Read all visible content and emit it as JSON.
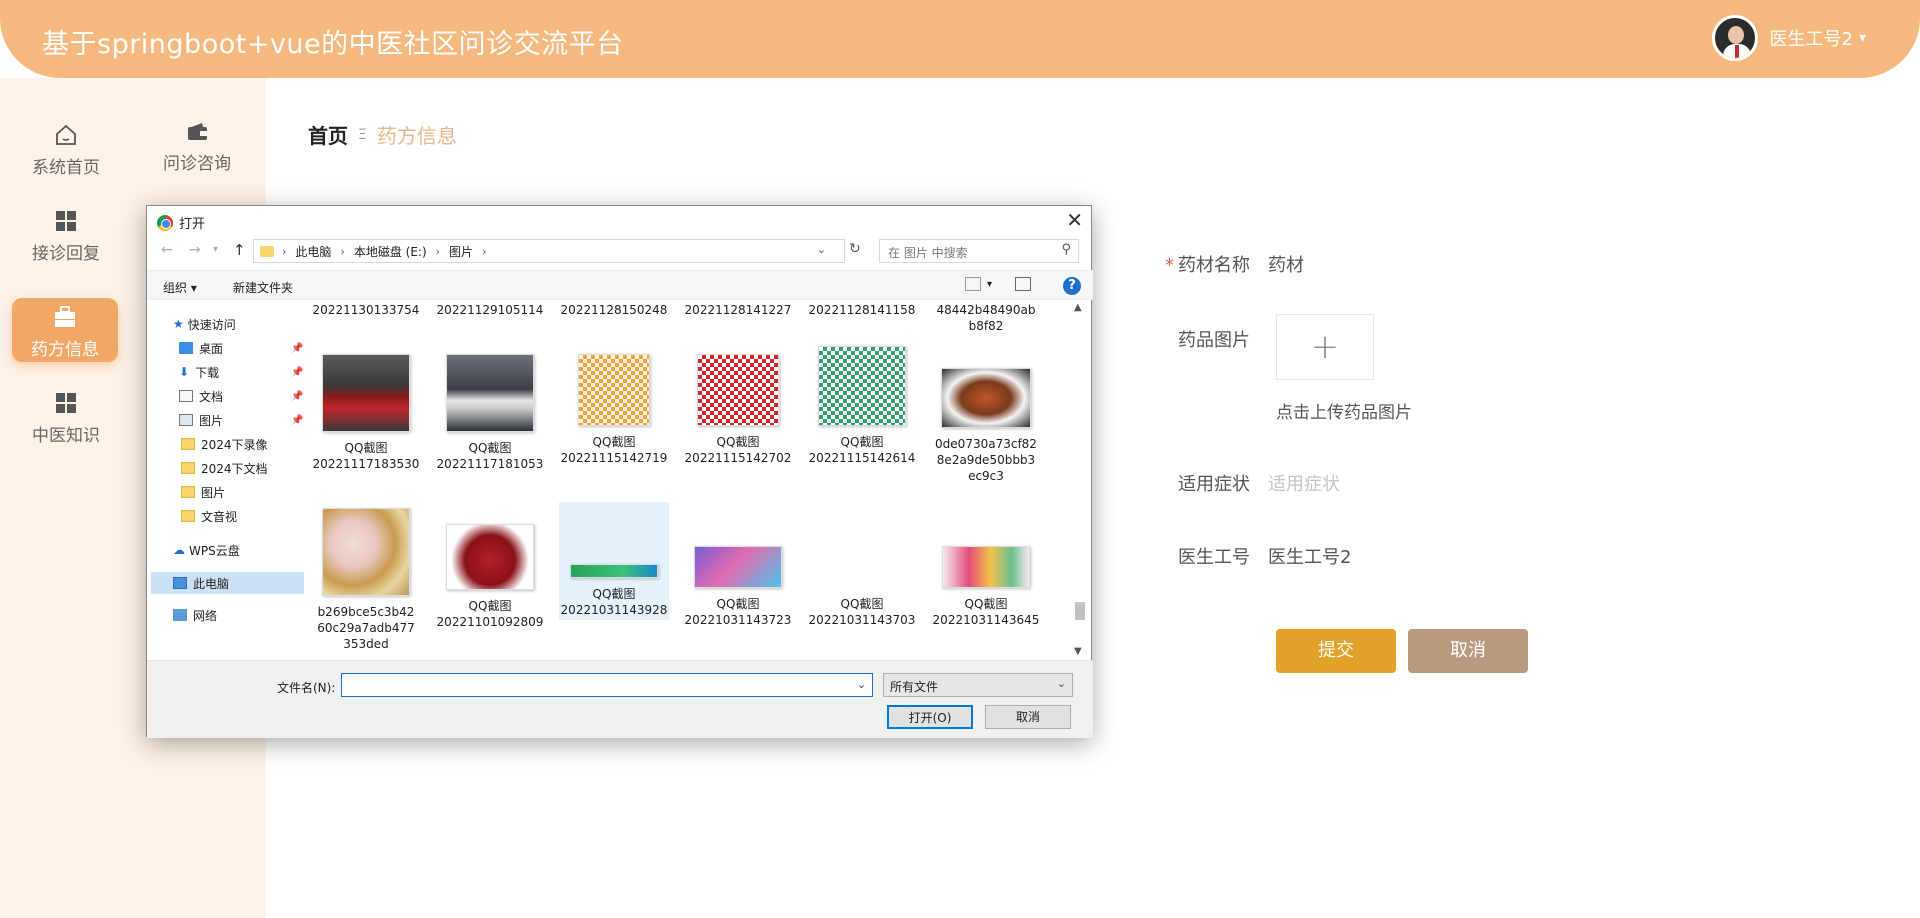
{
  "header": {
    "title": "基于springboot+vue的中医社区问诊交流平台",
    "user_name": "医生工号2",
    "caret": "▾"
  },
  "sidebar": {
    "items": [
      {
        "label": "系统首页",
        "icon": "home-icon"
      },
      {
        "label": "问诊咨询",
        "icon": "wallet-icon"
      },
      {
        "label": "接诊回复",
        "icon": "grid-icon"
      },
      {
        "label": "药方信息",
        "icon": "briefcase-icon",
        "active": true
      },
      {
        "label": "中医知识",
        "icon": "grid-icon"
      }
    ]
  },
  "breadcrumb": {
    "home": "首页",
    "separator": "Ξ",
    "current": "药方信息"
  },
  "form": {
    "name_label": "药材名称",
    "name_value": "药材",
    "image_label": "药品图片",
    "upload_plus": "+",
    "upload_hint": "点击上传药品图片",
    "symptom_label": "适用症状",
    "symptom_placeholder": "适用症状",
    "doctor_label": "医生工号",
    "doctor_value": "医生工号2",
    "submit_label": "提交",
    "cancel_label": "取消",
    "required_mark": "*"
  },
  "dialog": {
    "title": "打开",
    "close": "✕",
    "path": [
      "此电脑",
      "本地磁盘 (E:)",
      "图片"
    ],
    "search_placeholder": "在 图片 中搜索",
    "toolbar": {
      "organize": "组织 ▾",
      "new_folder": "新建文件夹",
      "help": "?"
    },
    "nav": {
      "quick_access": "快速访问",
      "desktop": "桌面",
      "downloads": "下载",
      "documents": "文档",
      "pictures": "图片",
      "f1": "2024下录像",
      "f2": "2024下文档",
      "f3": "图片",
      "f4": "文音视",
      "wps": "WPS云盘",
      "this_pc": "此电脑",
      "network": "网络"
    },
    "top_row": [
      "20221130133754",
      "20221129105114",
      "20221128150248",
      "20221128141227",
      "20221128141158",
      "48442b48490ab\nb8f82"
    ],
    "files_row1": [
      {
        "name1": "QQ截图",
        "name2": "20221117183530"
      },
      {
        "name1": "QQ截图",
        "name2": "20221117181053"
      },
      {
        "name1": "QQ截图",
        "name2": "20221115142719"
      },
      {
        "name1": "QQ截图",
        "name2": "20221115142702"
      },
      {
        "name1": "QQ截图",
        "name2": "20221115142614"
      },
      {
        "name1": "0de0730a73cf82",
        "name2": "8e2a9de50bbb3",
        "name3": "ec9c3"
      }
    ],
    "files_row2": [
      {
        "name1": "b269bce5c3b42",
        "name2": "60c29a7adb477",
        "name3": "353ded"
      },
      {
        "name1": "QQ截图",
        "name2": "20221101092809"
      },
      {
        "name1": "QQ截图",
        "name2": "20221031143928"
      },
      {
        "name1": "QQ截图",
        "name2": "20221031143723"
      },
      {
        "name1": "QQ截图",
        "name2": "20221031143703"
      },
      {
        "name1": "QQ截图",
        "name2": "20221031143645"
      }
    ],
    "filename_label": "文件名(N):",
    "filename_value": "",
    "filetype": "所有文件",
    "open_button": "打开(O)",
    "cancel_button": "取消"
  },
  "colors": {
    "accent": "#f5b97f",
    "active_nav": "#f1a766",
    "submit": "#e2a228",
    "cancel": "#b89a80"
  }
}
